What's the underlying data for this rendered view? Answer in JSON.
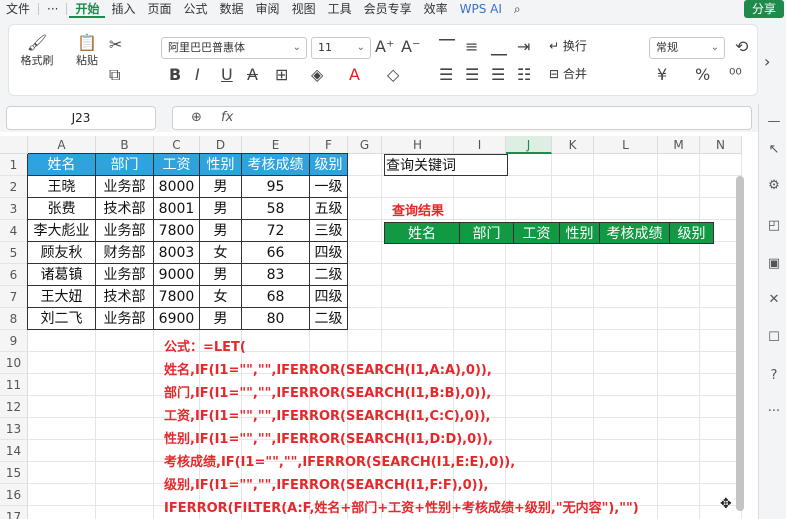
{
  "menubar": {
    "items": [
      "文件",
      "···",
      "开始",
      "插入",
      "页面",
      "公式",
      "数据",
      "审阅",
      "视图",
      "工具",
      "会员专享",
      "效率"
    ],
    "active": "开始",
    "wps_ai": "WPS AI",
    "share": "分享"
  },
  "ribbon": {
    "format_painter": "格式刷",
    "paste": "粘贴",
    "font_name": "阿里巴巴普惠体",
    "font_size": "11",
    "wrap": "换行",
    "merge": "合并",
    "number_format": "常规",
    "currency": "¥",
    "percent": "%"
  },
  "formula_bar": {
    "cell_ref": "J23",
    "fx": "fx",
    "content": ""
  },
  "sheet": {
    "columns": [
      "A",
      "B",
      "C",
      "D",
      "E",
      "F",
      "G",
      "H",
      "I",
      "J",
      "K",
      "L",
      "M",
      "N"
    ],
    "rows": [
      "1",
      "2",
      "3",
      "4",
      "5",
      "6",
      "7",
      "8",
      "9",
      "10",
      "11",
      "12",
      "13",
      "14",
      "15",
      "16",
      "17"
    ],
    "source_headers": [
      "姓名",
      "部门",
      "工资",
      "性别",
      "考核成绩",
      "级别"
    ],
    "source_rows": [
      [
        "王晓",
        "业务部",
        "8000",
        "男",
        "95",
        "一级"
      ],
      [
        "张费",
        "技术部",
        "8001",
        "男",
        "58",
        "五级"
      ],
      [
        "李大彪业",
        "业务部",
        "7800",
        "男",
        "72",
        "三级"
      ],
      [
        "顾友秋",
        "财务部",
        "8003",
        "女",
        "66",
        "四级"
      ],
      [
        "诸葛镇",
        "业务部",
        "9000",
        "男",
        "83",
        "二级"
      ],
      [
        "王大妞",
        "技术部",
        "7800",
        "女",
        "68",
        "四级"
      ],
      [
        "刘二飞",
        "业务部",
        "6900",
        "男",
        "80",
        "二级"
      ]
    ],
    "query_label": "查询关键词",
    "query_value": "",
    "result_title": "查询结果",
    "result_headers": [
      "姓名",
      "部门",
      "工资",
      "性别",
      "考核成绩",
      "级别"
    ],
    "formula_lines": [
      "公式：=LET(",
      "姓名,IF(I1=\"\",\"\",IFERROR(SEARCH(I1,A:A),0)),",
      "部门,IF(I1=\"\",\"\",IFERROR(SEARCH(I1,B:B),0)),",
      "工资,IF(I1=\"\",\"\",IFERROR(SEARCH(I1,C:C),0)),",
      "性别,IF(I1=\"\",\"\",IFERROR(SEARCH(I1,D:D),0)),",
      "考核成绩,IF(I1=\"\",\"\",IFERROR(SEARCH(I1,E:E),0)),",
      "级别,IF(I1=\"\",\"\",IFERROR(SEARCH(I1,F:F),0)),",
      "IFERROR(FILTER(A:F,姓名+部门+工资+性别+考核成绩+级别,\"无内容\"),\"\")",
      ")"
    ]
  },
  "colors": {
    "source_header": "#2ea3de",
    "result_header": "#119944",
    "formula_text": "#e6282b",
    "accent": "#1f8a4c"
  }
}
